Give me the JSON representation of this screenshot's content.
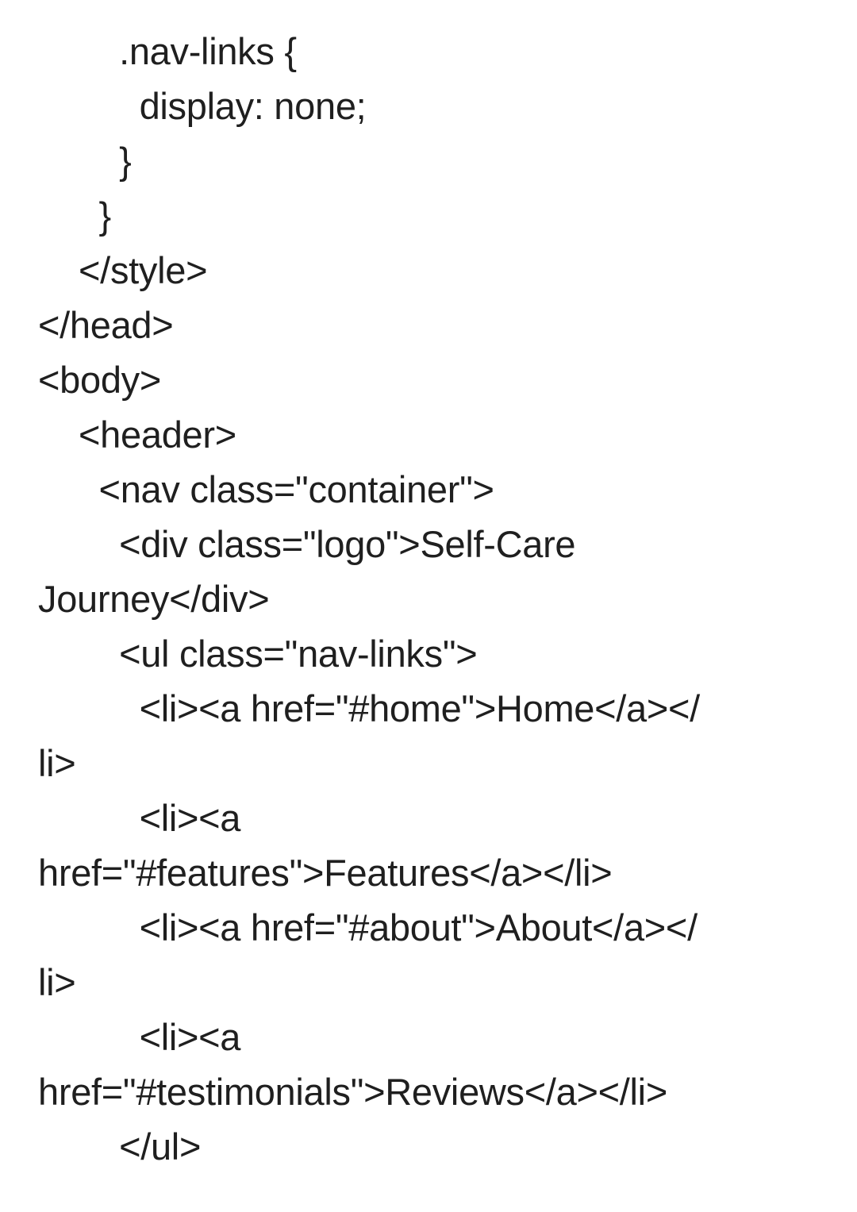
{
  "code_lines": [
    "        .nav-links {",
    "          display: none;",
    "        }",
    "      }",
    "    </style>",
    "</head>",
    "<body>",
    "    <header>",
    "      <nav class=\"container\">",
    "        <div class=\"logo\">Self-Care",
    "Journey</div>",
    "        <ul class=\"nav-links\">",
    "          <li><a href=\"#home\">Home</a></",
    "li>",
    "          <li><a",
    "href=\"#features\">Features</a></li>",
    "          <li><a href=\"#about\">About</a></",
    "li>",
    "          <li><a",
    "href=\"#testimonials\">Reviews</a></li>",
    "        </ul>"
  ]
}
